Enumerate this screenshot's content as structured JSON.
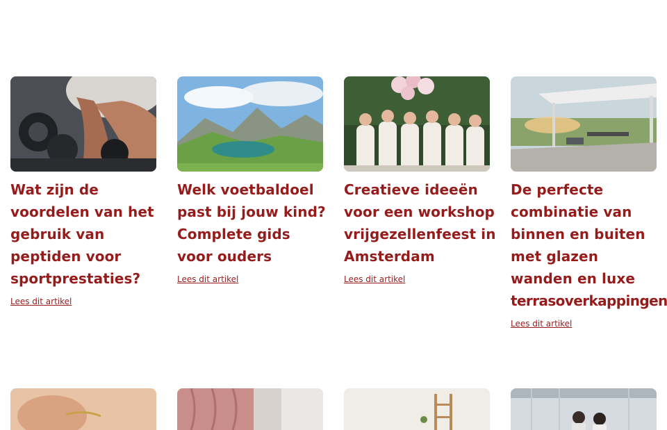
{
  "articles": [
    {
      "title_lines": [
        "Wat zijn de",
        "voordelen van het",
        "gebruik van",
        "peptiden voor",
        "sportprestaties?"
      ],
      "link": "Lees dit artikel",
      "image": "gym-dumbbell-photo"
    },
    {
      "title_lines": [
        "Welk voetbaldoel",
        "past bij jouw kind?",
        "Complete gids",
        "voor ouders"
      ],
      "link": "Lees dit artikel",
      "image": "mountain-lake-photo"
    },
    {
      "title_lines": [
        "Creatieve ideeën",
        "voor een workshop",
        "vrijgezellenfeest in",
        "Amsterdam"
      ],
      "link": "Lees dit artikel",
      "image": "bachelorette-party-photo"
    },
    {
      "title_lines": [
        "De perfecte",
        "combinatie van",
        "binnen en buiten",
        "met glazen",
        "wanden en luxe",
        "terrasoverkappingen"
      ],
      "link": "Lees dit artikel",
      "image": "terrace-canopy-photo"
    }
  ],
  "next_row_images": [
    "jewelry-hand-photo",
    "pink-fabric-photo",
    "shelf-interior-photo",
    "office-people-photo"
  ],
  "colors": {
    "accent": "#961c1c",
    "background": "#ffffff"
  }
}
